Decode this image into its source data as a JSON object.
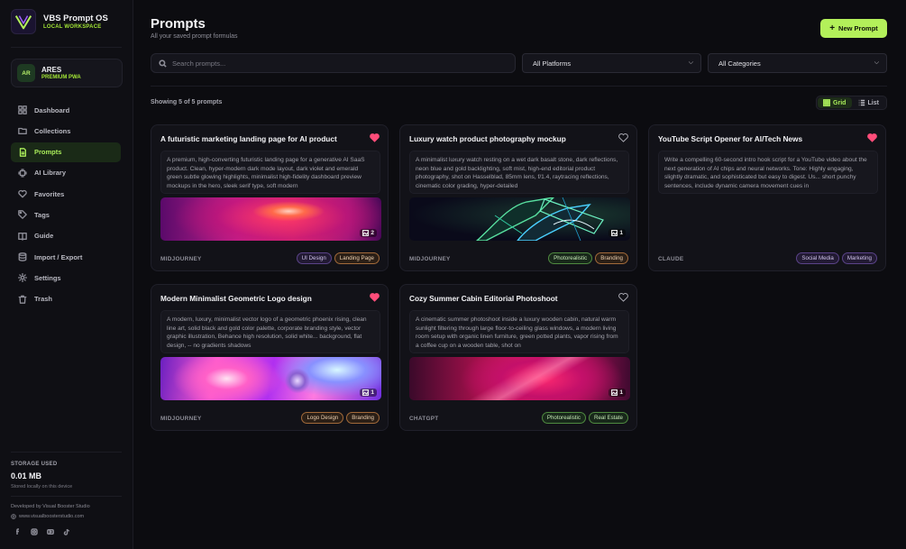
{
  "app": {
    "name": "VBS Prompt OS",
    "workspace": "LOCAL WORKSPACE",
    "logo_text": "VBS",
    "accent": "#b3f05a"
  },
  "user": {
    "initials": "AR",
    "name": "ARES",
    "plan": "PREMIUM PWA"
  },
  "nav": [
    {
      "label": "Dashboard",
      "icon": "dashboard-icon",
      "active": false
    },
    {
      "label": "Collections",
      "icon": "folder-icon",
      "active": false
    },
    {
      "label": "Prompts",
      "icon": "document-icon",
      "active": true
    },
    {
      "label": "AI Library",
      "icon": "chip-icon",
      "active": false
    },
    {
      "label": "Favorites",
      "icon": "heart-icon",
      "active": false
    },
    {
      "label": "Tags",
      "icon": "tag-icon",
      "active": false
    },
    {
      "label": "Guide",
      "icon": "book-icon",
      "active": false
    },
    {
      "label": "Import / Export",
      "icon": "database-icon",
      "active": false
    },
    {
      "label": "Settings",
      "icon": "gear-icon",
      "active": false
    },
    {
      "label": "Trash",
      "icon": "trash-icon",
      "active": false
    }
  ],
  "storage": {
    "label": "STORAGE USED",
    "value": "0.01 MB",
    "sub": "Stored locally on this device"
  },
  "footer": {
    "developer": "Developed by Visual Booster Studio",
    "site": "www.visualboosterstudio.com"
  },
  "socials": [
    "facebook-icon",
    "instagram-icon",
    "youtube-icon",
    "tiktok-icon"
  ],
  "header": {
    "title": "Prompts",
    "subtitle": "All your saved prompt formulas",
    "new_button": "New Prompt"
  },
  "filters": {
    "search_placeholder": "Search prompts...",
    "platform": "All Platforms",
    "category": "All Categories"
  },
  "list": {
    "count_text": "Showing 5 of 5 prompts",
    "view_grid": "Grid",
    "view_list": "List",
    "view_selected": "Grid"
  },
  "cards": [
    {
      "title": "A futuristic marketing landing page for AI product",
      "favorite": true,
      "description": "A premium, high-converting futuristic landing page for a generative AI SaaS product. Clean, hyper-modern dark mode layout, dark violet and emerald green subtle glowing highlights, minimalist high-fidelity dashboard preview mockups in the hero, sleek serif type, soft modern",
      "image_count": "2",
      "platform": "MIDJOURNEY",
      "tags": [
        {
          "label": "UI Design",
          "tone": "purple"
        },
        {
          "label": "Landing Page",
          "tone": "orange"
        }
      ]
    },
    {
      "title": "Luxury watch product photography mockup",
      "favorite": false,
      "description": "A minimalist luxury watch resting on a wet dark basalt stone, dark reflections, neon blue and gold backlighting, soft mist, high-end editorial product photography, shot on Hasselblad, 85mm lens, f/1.4, raytracing reflections, cinematic color grading, hyper-detailed",
      "image_count": "1",
      "platform": "MIDJOURNEY",
      "tags": [
        {
          "label": "Photorealistic",
          "tone": "green"
        },
        {
          "label": "Branding",
          "tone": "orange"
        }
      ]
    },
    {
      "title": "YouTube Script Opener for AI/Tech News",
      "favorite": true,
      "description": "Write a compelling 60-second intro hook script for a YouTube video about the next generation of AI chips and neural networks. Tone: Highly engaging, slightly dramatic, and sophisticated but easy to digest. Us... short punchy sentences, include dynamic camera movement cues in",
      "image_count": "",
      "platform": "CLAUDE",
      "tags": [
        {
          "label": "Social Media",
          "tone": "purple"
        },
        {
          "label": "Marketing",
          "tone": "purple"
        }
      ]
    },
    {
      "title": "Modern Minimalist Geometric Logo design",
      "favorite": true,
      "description": "A modern, luxury, minimalist vector logo of a geometric phoenix rising, clean line art, solid black and gold color palette, corporate branding style, vector graphic illustration, Behance high resolution, solid white... background, flat design, -- no gradients shadows",
      "image_count": "1",
      "platform": "MIDJOURNEY",
      "tags": [
        {
          "label": "Logo Design",
          "tone": "orange"
        },
        {
          "label": "Branding",
          "tone": "orange"
        }
      ]
    },
    {
      "title": "Cozy Summer Cabin Editorial Photoshoot",
      "favorite": false,
      "description": "A cinematic summer photoshoot inside a luxury wooden cabin, natural warm sunlight filtering through large floor-to-ceiling glass windows, a modern living room setup with organic linen furniture, green potted plants, vapor rising from a coffee cup on a wooden table, shot on",
      "image_count": "1",
      "platform": "CHATGPT",
      "tags": [
        {
          "label": "Photorealistic",
          "tone": "green"
        },
        {
          "label": "Real Estate",
          "tone": "green"
        }
      ]
    }
  ]
}
